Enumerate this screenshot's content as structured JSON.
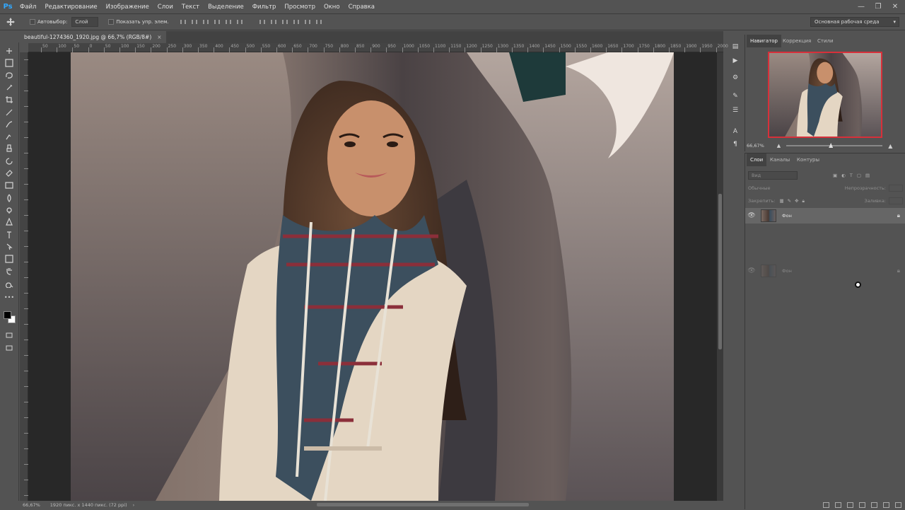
{
  "app": {
    "logo": "Ps"
  },
  "menu": [
    "Файл",
    "Редактирование",
    "Изображение",
    "Слои",
    "Текст",
    "Выделение",
    "Фильтр",
    "Просмотр",
    "Окно",
    "Справка"
  ],
  "window_controls": {
    "minimize": "—",
    "restore": "❐",
    "close": "✕"
  },
  "options": {
    "autoselect_label": "Автовыбор:",
    "autoselect_value": "Слой",
    "show_controls_label": "Показать упр. элем."
  },
  "workspace": "Основная рабочая среда",
  "document": {
    "tab_title": "beautiful-1274360_1920.jpg @ 66,7% (RGB/8#)",
    "close": "×"
  },
  "ruler": {
    "top_ticks": [
      "50",
      "100",
      "50",
      "0",
      "50",
      "100",
      "150",
      "200",
      "250",
      "300",
      "350",
      "400",
      "450",
      "500",
      "550",
      "600",
      "650",
      "700",
      "750",
      "800",
      "850",
      "900",
      "950",
      "1000",
      "1050",
      "1100",
      "1150",
      "1200",
      "1250",
      "1300",
      "1350",
      "1400",
      "1450",
      "1500",
      "1550",
      "1600",
      "1650",
      "1700",
      "1750",
      "1800",
      "1850",
      "1900",
      "1950",
      "2000",
      "2050"
    ]
  },
  "status": {
    "zoom": "66,67%",
    "doc_info": "1920 пикс. x 1440 пикс. (72 ppi)",
    "arrow": "›"
  },
  "navigator": {
    "tabs": [
      "Навигатор",
      "Коррекция",
      "Стили"
    ],
    "zoom": "66,67%"
  },
  "layers": {
    "tabs": [
      "Слои",
      "Каналы",
      "Контуры"
    ],
    "search_placeholder": "Вид",
    "blend_mode": "Обычные",
    "opacity_label": "Непрозрачность:",
    "lock_label": "Закрепить:",
    "fill_label": "Заливка:",
    "items": [
      {
        "name": "Фон"
      },
      {
        "name": "Фон"
      }
    ]
  },
  "colors": {
    "accent_ps": "#31a8ff",
    "navigator_frame": "#d7303a"
  },
  "icons": [
    "move-tool-icon",
    "marquee-tool-icon",
    "lasso-tool-icon",
    "quick-select-tool-icon",
    "crop-tool-icon",
    "eyedropper-tool-icon",
    "healing-brush-icon",
    "brush-tool-icon",
    "clone-stamp-icon",
    "history-brush-icon",
    "eraser-tool-icon",
    "gradient-tool-icon",
    "blur-tool-icon",
    "dodge-tool-icon",
    "pen-tool-icon",
    "type-tool-icon",
    "path-select-icon",
    "shape-tool-icon",
    "hand-tool-icon",
    "zoom-tool-icon"
  ]
}
